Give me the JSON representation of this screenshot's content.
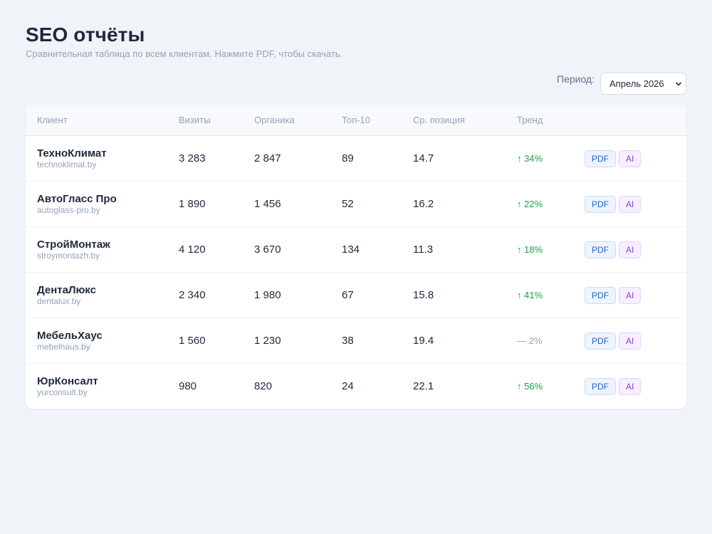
{
  "header": {
    "title": "SEO отчёты",
    "subtitle": "Сравнительная таблица по всем клиентам. Нажмите PDF, чтобы скачать."
  },
  "period": {
    "label": "Период:",
    "selected": "Апрель 2026"
  },
  "table": {
    "columns": [
      "Клиент",
      "Визиты",
      "Органика",
      "Топ-10",
      "Ср. позиция",
      "Тренд",
      ""
    ],
    "rows": [
      {
        "name": "ТехноКлимат",
        "domain": "technoklimat.by",
        "visits": "3 283",
        "organic": "2 847",
        "top10": "89",
        "avg_position": "14.7",
        "trend": "↑ 34%",
        "trend_dir": "up",
        "pdf": "PDF",
        "ai": "AI"
      },
      {
        "name": "АвтоГласс Про",
        "domain": "autoglass-pro.by",
        "visits": "1 890",
        "organic": "1 456",
        "top10": "52",
        "avg_position": "16.2",
        "trend": "↑ 22%",
        "trend_dir": "up",
        "pdf": "PDF",
        "ai": "AI"
      },
      {
        "name": "СтройМонтаж",
        "domain": "stroymontazh.by",
        "visits": "4 120",
        "organic": "3 670",
        "top10": "134",
        "avg_position": "11.3",
        "trend": "↑ 18%",
        "trend_dir": "up",
        "pdf": "PDF",
        "ai": "AI"
      },
      {
        "name": "ДентаЛюкс",
        "domain": "dentalux.by",
        "visits": "2 340",
        "organic": "1 980",
        "top10": "67",
        "avg_position": "15.8",
        "trend": "↑ 41%",
        "trend_dir": "up",
        "pdf": "PDF",
        "ai": "AI"
      },
      {
        "name": "МебельХаус",
        "domain": "mebelhaus.by",
        "visits": "1 560",
        "organic": "1 230",
        "top10": "38",
        "avg_position": "19.4",
        "trend": "— 2%",
        "trend_dir": "flat",
        "pdf": "PDF",
        "ai": "AI"
      },
      {
        "name": "ЮрКонсалт",
        "domain": "yurconsult.by",
        "visits": "980",
        "organic": "820",
        "top10": "24",
        "avg_position": "22.1",
        "trend": "↑ 56%",
        "trend_dir": "up",
        "pdf": "PDF",
        "ai": "AI"
      }
    ]
  },
  "colors": {
    "background": "#f0f3f8",
    "trend_up": "#16a34a",
    "trend_flat": "#94a3b8",
    "pdf_button": "#2563c9",
    "ai_button": "#8b3fc9"
  },
  "icons": {
    "select_chevron": "chevron-down-icon"
  }
}
